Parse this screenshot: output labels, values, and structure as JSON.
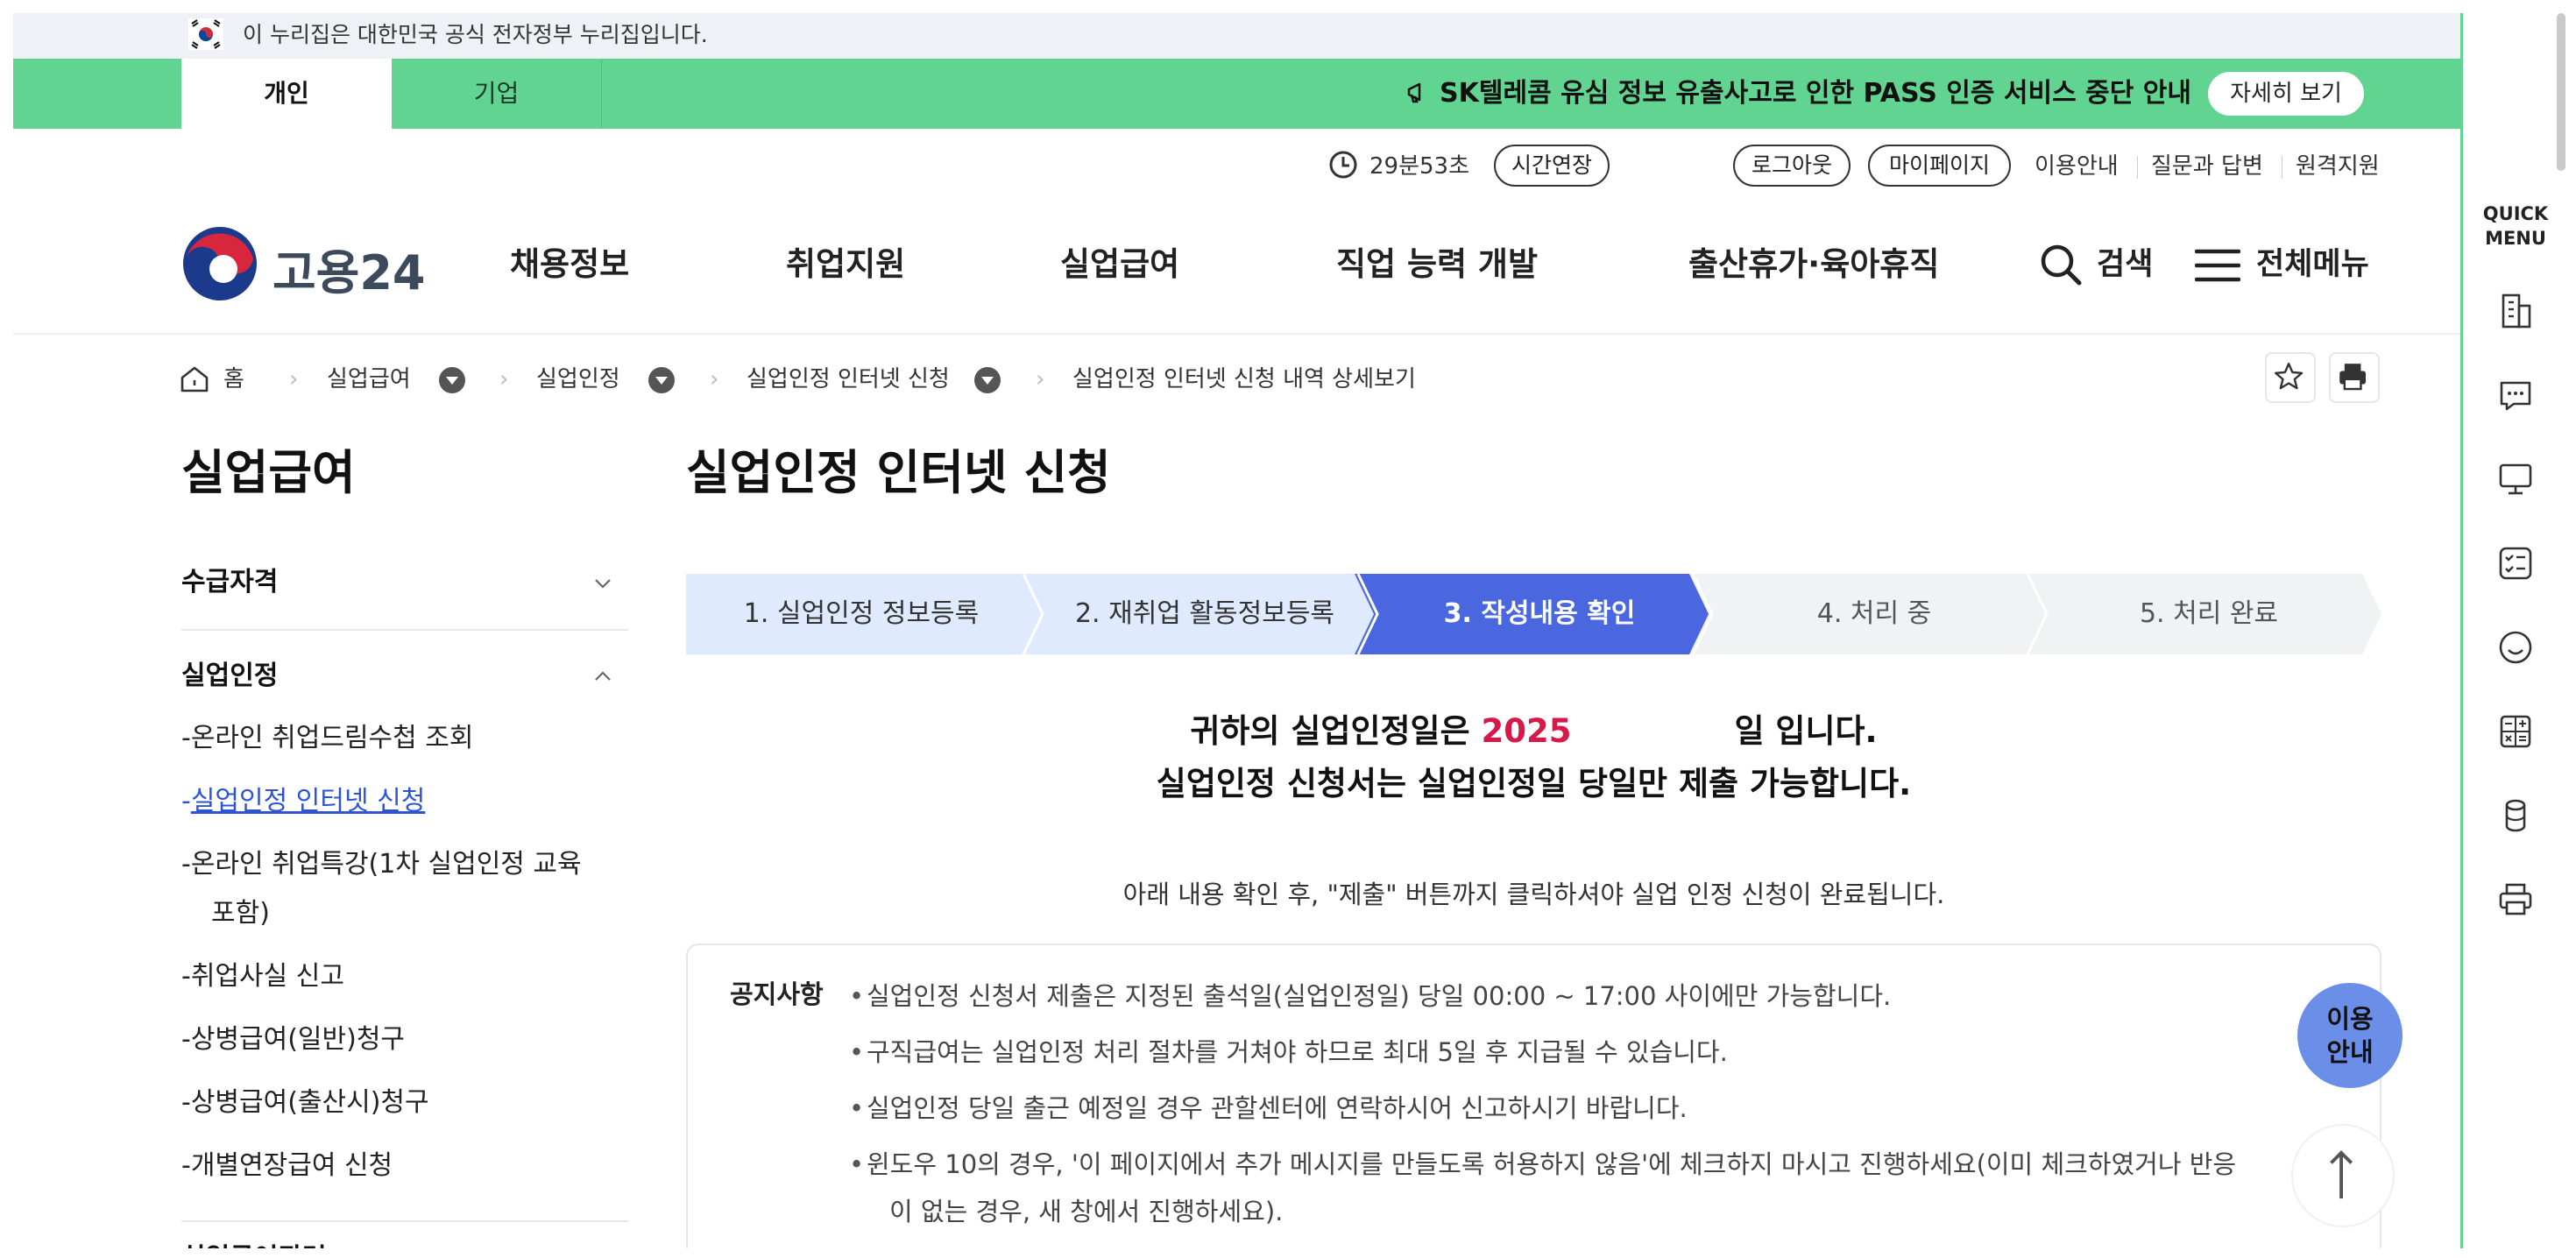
{
  "gov_banner": {
    "text": "이 누리집은 대한민국 공식 전자정부 누리집입니다.",
    "flag_icon": "korea-flag-icon"
  },
  "top_tabs": {
    "personal": "개인",
    "company": "기업"
  },
  "notice_bar": {
    "text": "SK텔레콤 유심 정보 유출사고로 인한 PASS 인증 서비스 중단 안내",
    "detail_button": "자세히 보기",
    "icon": "megaphone-icon"
  },
  "utility": {
    "timer": "29분53초",
    "extend_button": "시간연장",
    "logout_button": "로그아웃",
    "mypage_button": "마이페이지",
    "links": [
      "이용안내",
      "질문과 답변",
      "원격지원"
    ]
  },
  "header": {
    "logo_text": "고용24",
    "nav": [
      "채용정보",
      "취업지원",
      "실업급여",
      "직업 능력 개발",
      "출산휴가·육아휴직"
    ],
    "search_label": "검색",
    "menu_label": "전체메뉴"
  },
  "breadcrumb": {
    "home": "홈",
    "items": [
      "실업급여",
      "실업인정",
      "실업인정 인터넷 신청",
      "실업인정 인터넷 신청 내역 상세보기"
    ]
  },
  "sidebar": {
    "title": "실업급여",
    "groups": [
      {
        "label": "수급자격"
      },
      {
        "label": "실업인정"
      }
    ],
    "items": [
      "-온라인 취업드림수첩 조회",
      "실업인정 인터넷 신청",
      "-온라인 취업특강(1차 실업인정 교육",
      "포함)",
      "-취업사실 신고",
      "-상병급여(일반)청구",
      "-상병급여(출산시)청구",
      "-개별연장급여 신청"
    ],
    "next_group_partial": "실업급여관련"
  },
  "main": {
    "title": "실업인정 인터넷 신청",
    "steps": [
      "1. 실업인정 정보등록",
      "2. 재취업 활동정보등록",
      "3. 작성내용 확인",
      "4. 처리 중",
      "5. 처리 완료"
    ],
    "active_step": 3,
    "message_line1_prefix": "귀하의 실업인정일은 ",
    "message_year": "2025",
    "message_line1_suffix": "일 입니다.",
    "message_line2": "실업인정 신청서는 실업인정일 당일만 제출 가능합니다.",
    "instruction": "아래 내용 확인 후, \"제출\" 버튼까지 클릭하셔야 실업 인정 신청이 완료됩니다.",
    "notice_label": "공지사항",
    "notices": [
      "실업인정 신청서 제출은 지정된 출석일(실업인정일) 당일 00:00 ~ 17:00 사이에만 가능합니다.",
      "구직급여는 실업인정 처리 절차를 거쳐야 하므로 최대 5일 후 지급될 수 있습니다.",
      "실업인정 당일 출근 예정일 경우 관할센터에 연락하시어 신고하시기 바랍니다.",
      "윈도우 10의 경우, '이 페이지에서 추가 메시지를 만들도록 허용하지 않음'에 체크하지 마시고 진행하세요(이미 체크하였거나 반응"
    ],
    "notice_continuation": "이 없는 경우, 새 창에서 진행하세요)."
  },
  "floating": {
    "guide_label_line1": "이용",
    "guide_label_line2": "안내",
    "top_icon": "arrow-up-icon"
  },
  "quick_menu": {
    "title_line1": "QUICK",
    "title_line2": "MENU",
    "icons": [
      "building-icon",
      "chat-bubble-icon",
      "monitor-icon",
      "checklist-icon",
      "smile-icon",
      "calculator-icon",
      "coin-stack-icon",
      "printer-icon"
    ]
  },
  "colors": {
    "green": "#62d491",
    "step_active": "#4a67e0",
    "step_done": "#dfeaff",
    "step_pending": "#f1f2f4",
    "year_red": "#d6194b",
    "link_blue": "#2f54d3"
  }
}
